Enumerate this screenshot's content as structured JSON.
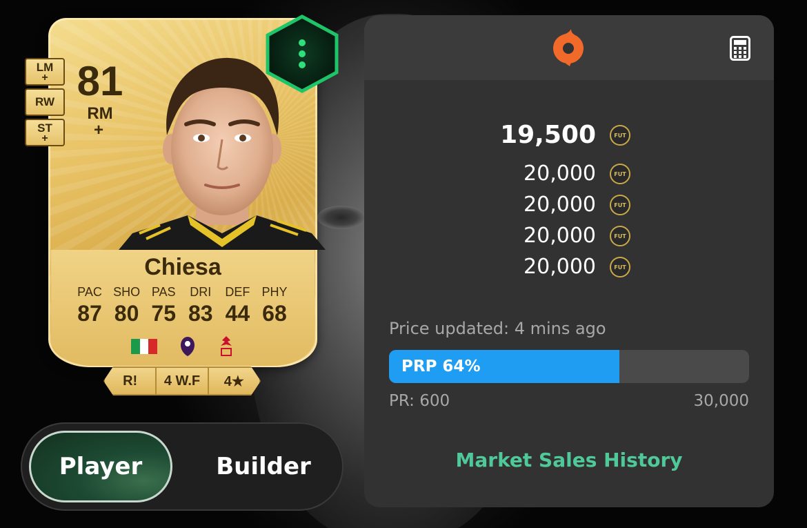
{
  "card": {
    "rating": "81",
    "position": "RM",
    "position_plus": "+",
    "alt_positions": [
      {
        "code": "LM",
        "plus": "+"
      },
      {
        "code": "RW",
        "plus": ""
      },
      {
        "code": "ST",
        "plus": "+"
      }
    ],
    "name": "Chiesa",
    "stats": [
      {
        "label": "PAC",
        "value": "87"
      },
      {
        "label": "SHO",
        "value": "80"
      },
      {
        "label": "PAS",
        "value": "75"
      },
      {
        "label": "DRI",
        "value": "83"
      },
      {
        "label": "DEF",
        "value": "44"
      },
      {
        "label": "PHY",
        "value": "68"
      }
    ],
    "nation_icon": "italy-flag-icon",
    "league_icon": "premier-league-icon",
    "club_icon": "liverpool-crest-icon",
    "chips": [
      "R!",
      "4 W.F",
      "4★"
    ]
  },
  "toggle": {
    "player_label": "Player",
    "builder_label": "Builder",
    "active": "player"
  },
  "panel": {
    "header_icon": "origin-logo-icon",
    "calculator_icon": "calculator-icon",
    "prices": [
      "19,500",
      "20,000",
      "20,000",
      "20,000",
      "20,000"
    ],
    "coin_label": "FUT",
    "updated_text": "Price updated: 4 mins ago",
    "prp_label": "PRP 64%",
    "prp_fraction": 0.64,
    "pr_min": "PR: 600",
    "pr_max": "30,000",
    "market_link": "Market Sales History"
  },
  "colors": {
    "accent_blue": "#1e9df2",
    "link_green": "#4fc99a",
    "hex_green": "#1ec46a",
    "origin_orange": "#f26a2a",
    "card_gold": "#e8c265"
  }
}
